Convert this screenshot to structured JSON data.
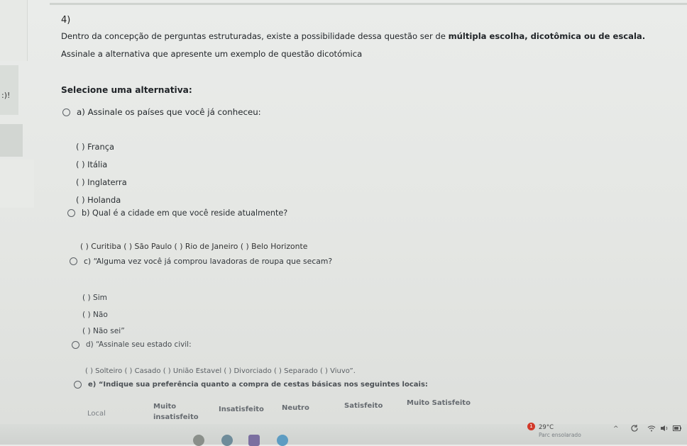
{
  "side": {
    "text": ":)!"
  },
  "question": {
    "number": "4)",
    "statement_plain": "Dentro da concepção de perguntas estruturadas, existe a possibilidade dessa questão ser de ",
    "statement_bold": "múltipla escolha, dicotômica ou de escala.",
    "instruction": "Assinale a alternativa que apresente um exemplo de questão dicotómica"
  },
  "select_prompt": "Selecione uma alternativa:",
  "options": {
    "a": {
      "label": "a) Assinale os países que você já conheceu:",
      "items": [
        "(  ) França",
        "(  ) Itália",
        "(  ) Inglaterra",
        "(  ) Holanda"
      ]
    },
    "b": {
      "label": "b) Qual é a cidade em que você reside atualmente?",
      "line": "(  ) Curitiba (  ) São Paulo (  ) Rio de Janeiro (  ) Belo Horizonte"
    },
    "c": {
      "label": "c) “Alguma vez você já comprou lavadoras de roupa que secam?",
      "items": [
        "( ) Sim",
        "( ) Não",
        "( ) Não sei”"
      ]
    },
    "d": {
      "label": "d) “Assinale seu estado civil:",
      "line": "( ) Solteiro (  ) Casado (  ) União Estavel (  ) Divorciado (  ) Separado  (  ) Viuvo”."
    },
    "e": {
      "label": "e) “Indique sua preferência quanto a compra de cestas básicas nos seguintes locais:",
      "headers": {
        "local": "Local",
        "muito_ins_1": "Muito",
        "muito_ins_2": "insatisfeito",
        "insat": "Insatisfeito",
        "neutro": "Neutro",
        "satis": "Satisfeito",
        "muito_sat": "Muito Satisfeito"
      }
    }
  },
  "taskbar": {
    "notification_count": "1",
    "temperature": "29°C",
    "weather": "Parc ensolarado"
  },
  "colors": {
    "notification": "#d23a2a",
    "radio_border": "#5c6166"
  }
}
